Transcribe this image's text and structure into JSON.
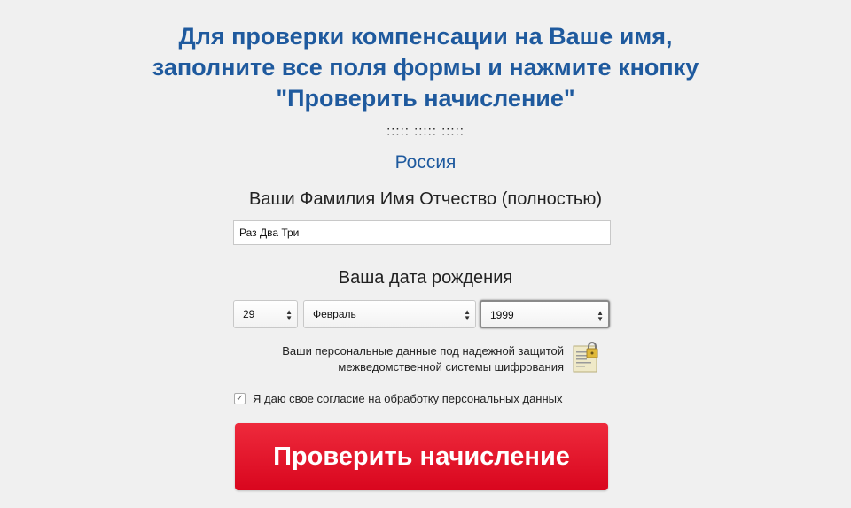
{
  "header": {
    "line1": "Для проверки компенсации на Ваше имя,",
    "line2": "заполните все поля формы и нажмите кнопку",
    "line3": "\"Проверить начисление\""
  },
  "separator": "::::: ::::: :::::",
  "country": "Россия",
  "fio": {
    "label": "Ваши Фамилия Имя Отчество (полностью)",
    "value": "Раз Два Три"
  },
  "birthdate": {
    "label": "Ваша дата рождения",
    "day": "29",
    "month": "Февраль",
    "year": "1999"
  },
  "privacy": {
    "line1": "Ваши персональные данные под надежной защитой",
    "line2": "межведомственной системы шифрования",
    "icon": "lock-document-icon"
  },
  "consent": {
    "label": "Я даю свое согласие на обработку персональных данных",
    "checked": true
  },
  "submit_label": "Проверить начисление",
  "colors": {
    "heading": "#1f5a9e",
    "button": "#e3142b",
    "background": "#f0f0f0"
  }
}
